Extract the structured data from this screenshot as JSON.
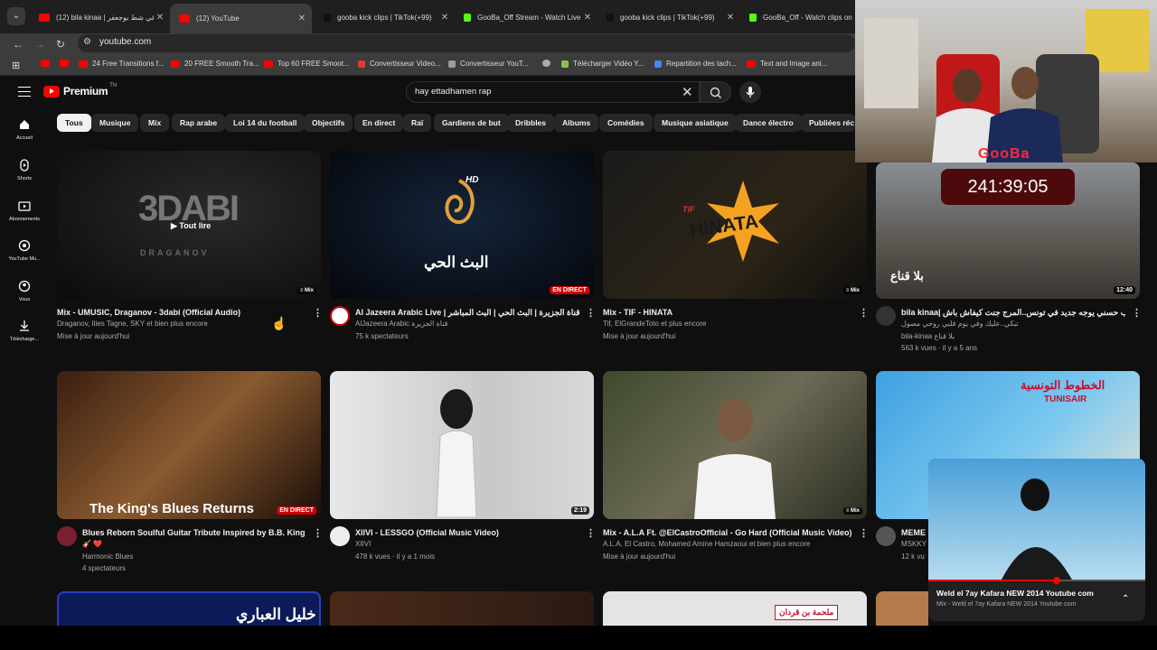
{
  "browser": {
    "tabs": [
      {
        "title": "(12) bila kinaa | في شط بوجعفر",
        "favicon": "yt"
      },
      {
        "title": "(12) YouTube",
        "favicon": "yt"
      },
      {
        "title": "gooba kick clips | TikTok(+99)",
        "favicon": "tiktok"
      },
      {
        "title": "GooBa_Off Stream - Watch Live",
        "favicon": "kick"
      },
      {
        "title": "gooba kick clips | TikTok(+99)",
        "favicon": "tiktok"
      },
      {
        "title": "GooBa_Off - Watch clips on",
        "favicon": "kick"
      }
    ],
    "url": "youtube.com",
    "bookmarks": [
      {
        "label": "",
        "color": "#ff0000"
      },
      {
        "label": "",
        "color": "#ff0000"
      },
      {
        "label": "24 Free Transitions f...",
        "color": "#ff0000"
      },
      {
        "label": "20 FREE Smooth Tra...",
        "color": "#ff0000"
      },
      {
        "label": "Top 60 FREE Smoot...",
        "color": "#ff0000"
      },
      {
        "label": "Convertisseur Video...",
        "color": "#e53935"
      },
      {
        "label": "Convertisseur YouT...",
        "color": "#9e9e9e"
      },
      {
        "label": "",
        "color": "#aaaaaa"
      },
      {
        "label": "Télécharger Vidéo Y...",
        "color": "#8bc34a"
      },
      {
        "label": "Repartition des tach...",
        "color": "#4285f4"
      },
      {
        "label": "Text and Image ani...",
        "color": "#ff0000"
      }
    ]
  },
  "youtube": {
    "logo": "Premium",
    "logo_tm": "TN",
    "search_value": "hay ettadhamen rap",
    "sidebar": [
      {
        "label": "Accueil",
        "icon": "home-icon"
      },
      {
        "label": "Shorts",
        "icon": "shorts-icon"
      },
      {
        "label": "Abonnements",
        "icon": "subscriptions-icon"
      },
      {
        "label": "YouTube Mu...",
        "icon": "youtube-music-icon"
      },
      {
        "label": "Vous",
        "icon": "you-icon"
      },
      {
        "label": "Télécharge...",
        "icon": "downloads-icon"
      }
    ],
    "chips": [
      "Tous",
      "Musique",
      "Mix",
      "Rap arabe",
      "Loi 14 du football",
      "Objectifs",
      "En direct",
      "Raï",
      "Gardiens de but",
      "Dribbles",
      "Albums",
      "Comédies",
      "Musique asiatique",
      "Dance électro",
      "Publiées réc"
    ],
    "videos": [
      {
        "title": "Mix - UMUSIC, Draganov - 3dabi (Official Audio)",
        "meta1": "Draganov, Ilies Tagne, SKY et bien plus encore",
        "meta2": "Mise à jour aujourd'hui",
        "meta3": "",
        "badge": "Mix",
        "overlay": "Tout lire",
        "thumb_text": "3DABI",
        "thumb_sub": "DRAGANOV"
      },
      {
        "title": "Al Jazeera Arabic Live | قناة الجزيرة | البث الحي | البث المباشر",
        "meta1": "AlJazeera Arabic قناة الجزيرة",
        "meta2": "75 k spectateurs",
        "meta3": "",
        "badge": "EN DIRECT",
        "overlay": "",
        "thumb_text": "البث الحي",
        "thumb_sub": "HD"
      },
      {
        "title": "Mix - TIF - HINATA",
        "meta1": "Tif, ElGrandeToto et plus encore",
        "meta2": "Mise à jour aujourd'hui",
        "meta3": "",
        "badge": "Mix",
        "overlay": "",
        "thumb_text": "HINATA",
        "thumb_sub": "TIF"
      },
      {
        "title": "bila kinaa| شاب حسني يوجه جديد في تونس..المرج جنت كيفاش باش",
        "meta1": "تبكي..عليك وفي يوم قلبي روحي مصول",
        "meta2": "bila-kinaa بلا قناع",
        "meta3": "563 k vues · il y a 5 ans",
        "badge": "12:40",
        "overlay": "",
        "thumb_text": "بلا قناع",
        "thumb_sub": ""
      },
      {
        "title": "Blues Reborn Soulful Guitar Tribute Inspired by B.B. King",
        "meta1": "🎸 ❤️",
        "meta2": "Harmonic Blues",
        "meta3": "4 spectateurs",
        "badge": "EN DIRECT",
        "overlay": "",
        "thumb_text": "The King's Blues Returns",
        "thumb_sub": ""
      },
      {
        "title": "XIIVI - LESSGO (Official Music Video)",
        "meta1": "XIIVI",
        "meta2": "478 k vues · il y a 1 mois",
        "meta3": "",
        "badge": "2:19",
        "overlay": "",
        "thumb_text": "",
        "thumb_sub": ""
      },
      {
        "title": "Mix - A.L.A Ft. @ElCastroOfficial - Go Hard (Official Music Video)",
        "meta1": "A.L.A, El Castro, Mohamed Amine Hamzaoui et bien plus encore",
        "meta2": "Mise à jour aujourd'hui",
        "meta3": "",
        "badge": "Mix",
        "overlay": "",
        "thumb_text": "",
        "thumb_sub": ""
      },
      {
        "title": "MEME",
        "meta1": "MSKKY",
        "meta2": "12 k vu",
        "meta3": "",
        "badge": "",
        "overlay": "",
        "thumb_text": "الخطوط التونسية",
        "thumb_sub": "TUNISAIR"
      }
    ],
    "third_row": [
      "خليل العباري",
      "",
      "ملحمة بن قردان",
      ""
    ]
  },
  "stream_overlay": {
    "name": "GooBa",
    "timer": "241:39:05"
  },
  "miniplayer": {
    "title": "Weld el 7ay Kafara NEW 2014 Youtube com",
    "subtitle": "Mix - Weld el 7ay Kafara NEW 2014 Youtube com",
    "progress": 0.59
  }
}
